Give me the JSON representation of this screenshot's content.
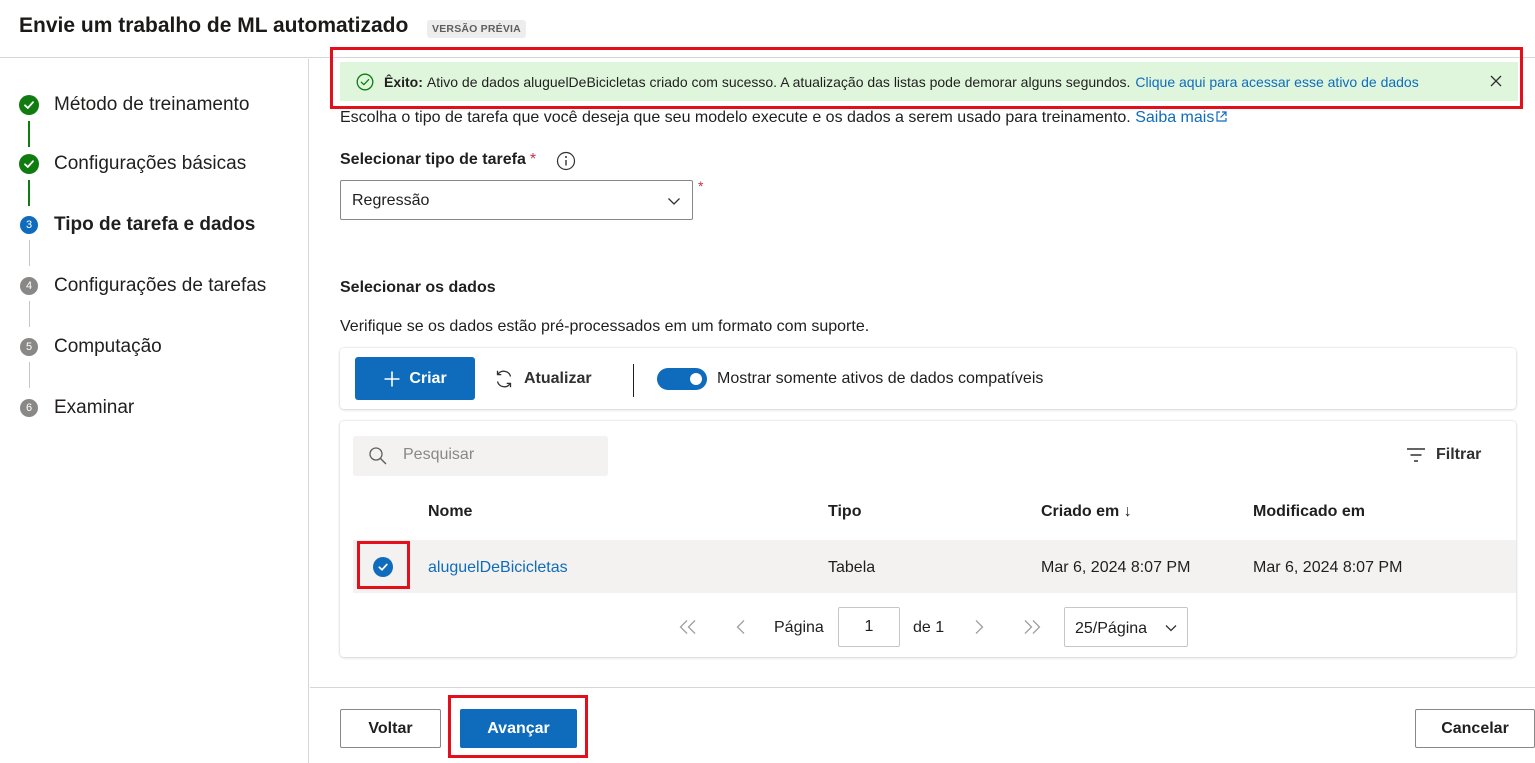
{
  "header": {
    "title": "Envie um trabalho de ML automatizado",
    "badge": "VERSÃO PRÉVIA"
  },
  "steps": [
    {
      "number": "",
      "label": "Método de treinamento",
      "state": "done"
    },
    {
      "number": "",
      "label": "Configurações básicas",
      "state": "done"
    },
    {
      "number": "3",
      "label": "Tipo de tarefa e dados",
      "state": "active"
    },
    {
      "number": "4",
      "label": "Configurações de tarefas",
      "state": "pending"
    },
    {
      "number": "5",
      "label": "Computação",
      "state": "pending"
    },
    {
      "number": "6",
      "label": "Examinar",
      "state": "pending"
    }
  ],
  "alert": {
    "strong": "Êxito:",
    "message": "Ativo de dados aluguelDeBicicletas criado com sucesso. A atualização das listas pode demorar alguns segundos.",
    "link": "Clique aqui para acessar esse ativo de dados"
  },
  "intro": {
    "text": "Escolha o tipo de tarefa que você deseja que seu modelo execute e os dados a serem usado para treinamento.",
    "link": "Saiba mais"
  },
  "task_type": {
    "label": "Selecionar tipo de tarefa",
    "required": "*",
    "value": "Regressão"
  },
  "data_section": {
    "title": "Selecionar os dados",
    "description": "Verifique se os dados estão pré-processados em um formato com suporte."
  },
  "toolbar": {
    "create": "Criar",
    "refresh": "Atualizar",
    "toggle_label": "Mostrar somente ativos de dados compatíveis",
    "toggle_on": true
  },
  "table": {
    "search_placeholder": "Pesquisar",
    "filter": "Filtrar",
    "columns": [
      "Nome",
      "Tipo",
      "Criado em ↓",
      "Modificado em"
    ],
    "rows": [
      {
        "name": "aluguelDeBicicletas",
        "type": "Tabela",
        "created": "Mar 6, 2024 8:07 PM",
        "modified": "Mar 6, 2024 8:07 PM",
        "selected": true
      }
    ]
  },
  "pagination": {
    "page_label": "Página",
    "page": "1",
    "of": "de 1",
    "page_size": "25/Página"
  },
  "footer": {
    "back": "Voltar",
    "next": "Avançar",
    "cancel": "Cancelar"
  },
  "colors": {
    "primary": "#0f6cbd",
    "success": "#107c10",
    "alert_bg": "#dff6dd",
    "highlight": "#e3101b"
  }
}
